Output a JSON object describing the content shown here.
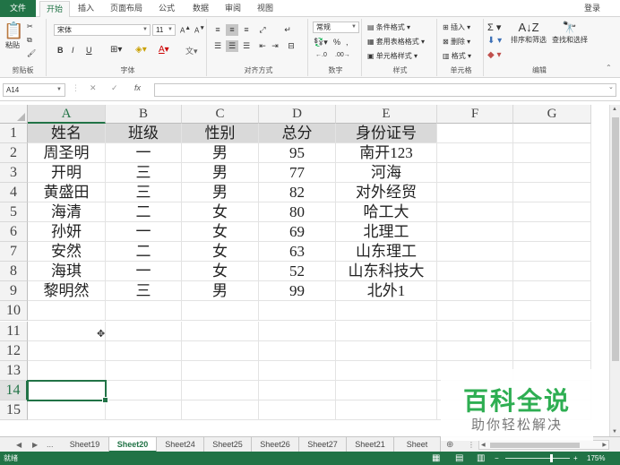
{
  "tabs": {
    "file": "文件",
    "items": [
      "开始",
      "插入",
      "页面布局",
      "公式",
      "数据",
      "审阅",
      "视图"
    ],
    "login": "登录"
  },
  "ribbon": {
    "clipboard": {
      "label": "剪贴板",
      "paste": "粘贴"
    },
    "font": {
      "label": "字体",
      "font_name": "宋体",
      "font_size": "11",
      "bold": "B",
      "italic": "I",
      "underline": "U"
    },
    "alignment": {
      "label": "对齐方式"
    },
    "number": {
      "label": "数字",
      "format": "常规"
    },
    "styles": {
      "label": "样式",
      "conditional": "条件格式",
      "table": "套用表格格式",
      "cell_styles": "单元格样式"
    },
    "cells": {
      "label": "单元格",
      "insert": "插入",
      "delete": "删除",
      "format": "格式"
    },
    "editing": {
      "label": "编辑",
      "sort_filter": "排序和筛选",
      "find_select": "查找和选择"
    }
  },
  "formula_bar": {
    "name_box": "A14",
    "fx": "fx",
    "value": ""
  },
  "columns": [
    "A",
    "B",
    "C",
    "D",
    "E",
    "F",
    "G"
  ],
  "rows": [
    "1",
    "2",
    "3",
    "4",
    "5",
    "6",
    "7",
    "8",
    "9",
    "10",
    "11",
    "12",
    "13",
    "14",
    "15"
  ],
  "table": {
    "header": [
      "姓名",
      "班级",
      "性别",
      "总分",
      "身份证号"
    ],
    "rows": [
      [
        "周圣明",
        "一",
        "男",
        "95",
        "南开123"
      ],
      [
        "开明",
        "三",
        "男",
        "77",
        "河海"
      ],
      [
        "黄盛田",
        "三",
        "男",
        "82",
        "对外经贸"
      ],
      [
        "海清",
        "二",
        "女",
        "80",
        "哈工大"
      ],
      [
        "孙妍",
        "一",
        "女",
        "69",
        "北理工"
      ],
      [
        "安然",
        "二",
        "女",
        "63",
        "山东理工"
      ],
      [
        "海琪",
        "一",
        "女",
        "52",
        "山东科技大"
      ],
      [
        "黎明然",
        "三",
        "男",
        "99",
        "北外1"
      ]
    ]
  },
  "sheets": {
    "ellipsis": "...",
    "tabs": [
      "Sheet19",
      "Sheet20",
      "Sheet24",
      "Sheet25",
      "Sheet26",
      "Sheet27",
      "Sheet21",
      "Sheet"
    ],
    "active": "Sheet20"
  },
  "status": {
    "ready": "就绪",
    "zoom": "175%"
  },
  "watermark": {
    "title": "百科全说",
    "subtitle": "助你轻松解决"
  },
  "colors": {
    "accent": "#217346",
    "header_fill": "#d9d9d9",
    "watermark_green": "#2eae52"
  }
}
